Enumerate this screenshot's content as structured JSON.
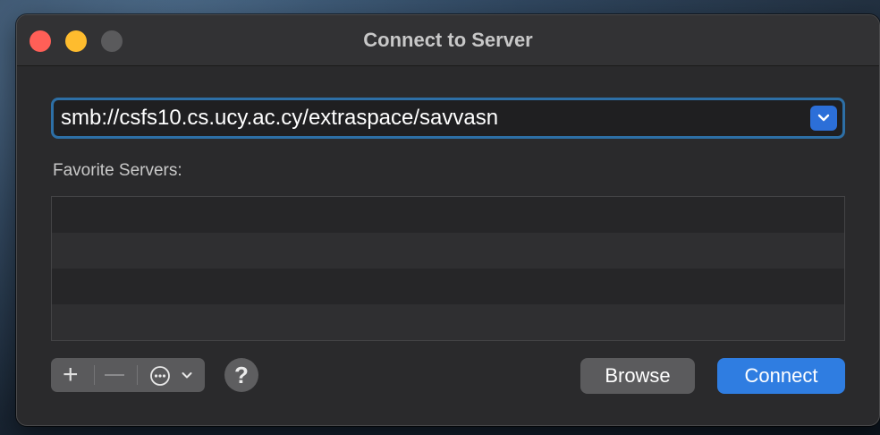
{
  "window": {
    "title": "Connect to Server"
  },
  "server_address": {
    "value": "smb://csfs10.cs.ucy.ac.cy/extraspace/savvasn"
  },
  "favorites": {
    "label": "Favorite Servers:",
    "items": []
  },
  "toolbar": {
    "add_icon": "plus-icon",
    "remove_icon": "minus-icon",
    "more_icon": "ellipsis-circle-icon",
    "help_label": "?"
  },
  "buttons": {
    "browse_label": "Browse",
    "connect_label": "Connect"
  },
  "colors": {
    "accent": "#2f7de1",
    "focus_ring": "#2d6fa6",
    "close": "#ff5f57",
    "minimize": "#febc2e"
  }
}
